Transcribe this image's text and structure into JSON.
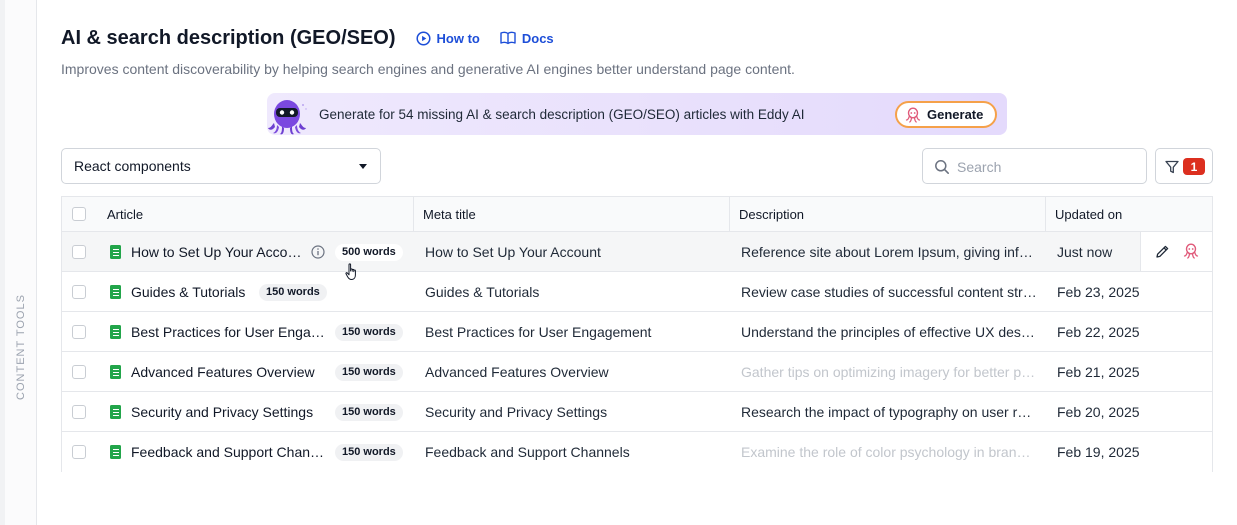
{
  "sidebar": {
    "vertical_label": "CONTENT TOOLS"
  },
  "header": {
    "title": "AI & search description (GEO/SEO)",
    "how_to_label": "How to",
    "docs_label": "Docs",
    "subtitle": "Improves content discoverability by helping search engines and generative AI engines better understand page content."
  },
  "banner": {
    "text": "Generate for 54 missing AI & search description (GEO/SEO) articles with Eddy AI",
    "button_label": "Generate"
  },
  "controls": {
    "selected_category": "React components",
    "search_placeholder": "Search",
    "filter_count": "1"
  },
  "table": {
    "columns": {
      "article": "Article",
      "meta_title": "Meta title",
      "description": "Description",
      "updated_on": "Updated on"
    },
    "rows": [
      {
        "article": "How to Set Up Your Account",
        "words": "500 words",
        "meta_title": "How to Set Up Your Account",
        "description": "Reference site about Lorem Ipsum, giving information on its origins, as well as a random Lipsum generator.",
        "description_placeholder": false,
        "updated": "Just now"
      },
      {
        "article": "Guides & Tutorials",
        "words": "150 words",
        "meta_title": "Guides & Tutorials",
        "description": "Review case studies of successful content strategies across industries.",
        "description_placeholder": false,
        "updated": "Feb 23, 2025"
      },
      {
        "article": "Best Practices for User Engagement",
        "words": "150 words",
        "meta_title": "Best Practices for User Engagement",
        "description": "Understand the principles of effective UX design for documentation.",
        "description_placeholder": false,
        "updated": "Feb 22, 2025"
      },
      {
        "article": "Advanced Features Overview",
        "words": "150 words",
        "meta_title": "Advanced Features Overview",
        "description": "Gather tips on optimizing imagery for better page performance.",
        "description_placeholder": true,
        "updated": "Feb 21, 2025"
      },
      {
        "article": "Security and Privacy Settings",
        "words": "150 words",
        "meta_title": "Security and Privacy Settings",
        "description": "Research the impact of typography on user readability and comprehension.",
        "description_placeholder": false,
        "updated": "Feb 20, 2025"
      },
      {
        "article": "Feedback and Support Channels",
        "words": "150 words",
        "meta_title": "Feedback and Support Channels",
        "description": "Examine the role of color psychology in branding and design.",
        "description_placeholder": true,
        "updated": "Feb 19, 2025"
      }
    ]
  },
  "icons": {
    "how_to": "play-circle-icon",
    "docs": "book-open-icon",
    "search": "search-icon",
    "filter": "funnel-icon",
    "doc": "document-icon",
    "info": "info-icon",
    "edit": "pencil-icon",
    "ai": "eddy-ai-octopus-icon"
  },
  "colors": {
    "link": "#1d4ed8",
    "doc_icon": "#22a54a",
    "badge": "#dc2f1f",
    "ai_accent": "#e05a7a",
    "banner_bg": "#e9e1fc",
    "generate_border": "#f5a14a"
  }
}
